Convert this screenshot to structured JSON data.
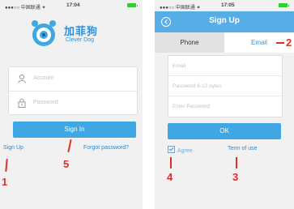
{
  "screen1": {
    "status": {
      "signal": "●●●○○ 中国联通 ✦",
      "time": "17:04"
    },
    "logo": {
      "name_cn": "加菲狗",
      "name_en": "Clever Dog"
    },
    "account_placeholder": "Account",
    "password_placeholder": "Password",
    "signin_label": "Sign In",
    "signup_label": "Sign Up",
    "forgot_label": "Forgot password?",
    "annotations": [
      "1",
      "5"
    ]
  },
  "screen2": {
    "status": {
      "signal": "●●●○○ 中国联通 ✦",
      "time": "17:05"
    },
    "title": "Sign Up",
    "tabs": [
      "Phone",
      "Email"
    ],
    "email_placeholder": "Email",
    "password_placeholder": "Password 6-12 bytes",
    "confirm_placeholder": "Enter Password",
    "ok_label": "OK",
    "agree_label": "Agree",
    "terms_label": "Term of use",
    "annotations": [
      "2",
      "4",
      "3"
    ]
  },
  "colors": {
    "accent": "#3fa7e3",
    "annotation": "#d8312a",
    "link": "#2b8ad2"
  }
}
